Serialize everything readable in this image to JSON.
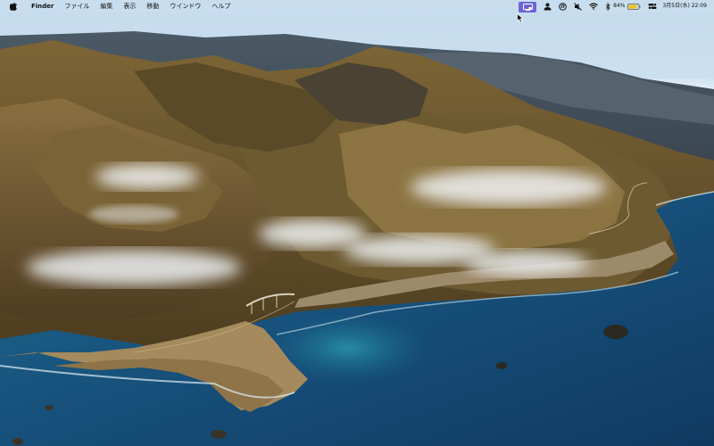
{
  "menubar": {
    "apple_icon": "apple-logo-icon",
    "app_name": "Finder",
    "menus": [
      "ファイル",
      "編集",
      "表示",
      "移動",
      "ウインドウ",
      "ヘルプ"
    ],
    "status": {
      "icons": [
        "screen-share-icon",
        "user-icon",
        "music-recognition-icon",
        "mute-icon",
        "wifi-icon",
        "bluetooth-icon",
        "battery-icon",
        "control-center-icon"
      ],
      "battery_percent": "84%",
      "datetime": "3月5日(水) 22:09",
      "highlight_color": "#6e64d8"
    }
  },
  "desktop": {
    "wallpaper": "big-sur-coastline-wallpaper"
  }
}
